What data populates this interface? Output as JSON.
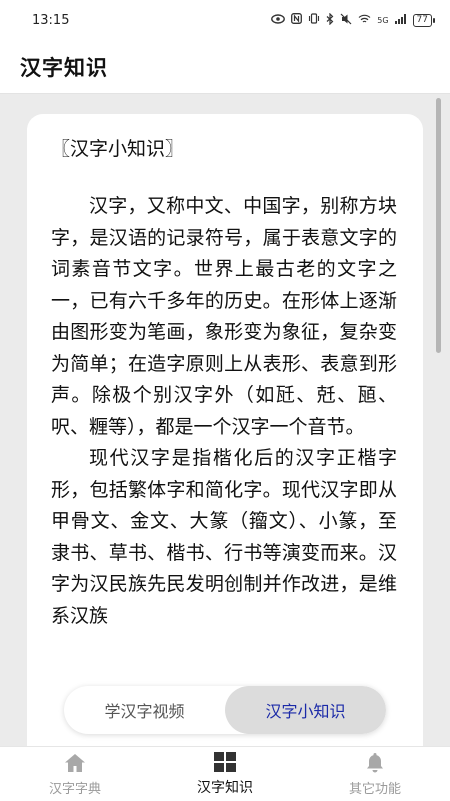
{
  "status_bar": {
    "time": "13:15",
    "network": "5G",
    "battery": "77"
  },
  "app_bar": {
    "title": "汉字知识"
  },
  "card": {
    "heading": "〖汉字小知识〗",
    "paragraphs": [
      "汉字，又称中文、中国字，别称方块字，是汉语的记录符号，属于表意文字的词素音节文字。世界上最古老的文字之一，已有六千多年的历史。在形体上逐渐由图形变为笔画，象形变为象征，复杂变为简单；在造字原则上从表形、表意到形声。除极个别汉字外（如瓩、兛、瓸、呎、糎等），都是一个汉字一个音节。",
      "现代汉字是指楷化后的汉字正楷字形，包括繁体字和简化字。现代汉字即从甲骨文、金文、大篆（籀文）、小篆，至隶书、草书、楷书、行书等演变而来。汉字为汉民族先民发明创制并作改进，是维系汉族"
    ]
  },
  "segmented": {
    "video_label": "学汉字视频",
    "knowledge_label": "汉字小知识",
    "active": "knowledge"
  },
  "bottom_nav": {
    "items": [
      {
        "label": "汉字字典",
        "icon": "home-icon"
      },
      {
        "label": "汉字知识",
        "icon": "grid-icon"
      },
      {
        "label": "其它功能",
        "icon": "bell-icon"
      }
    ],
    "active_index": 1
  },
  "colors": {
    "accent": "#1b2aa8",
    "background": "#ebebeb",
    "inactive": "#9a9a9a"
  }
}
